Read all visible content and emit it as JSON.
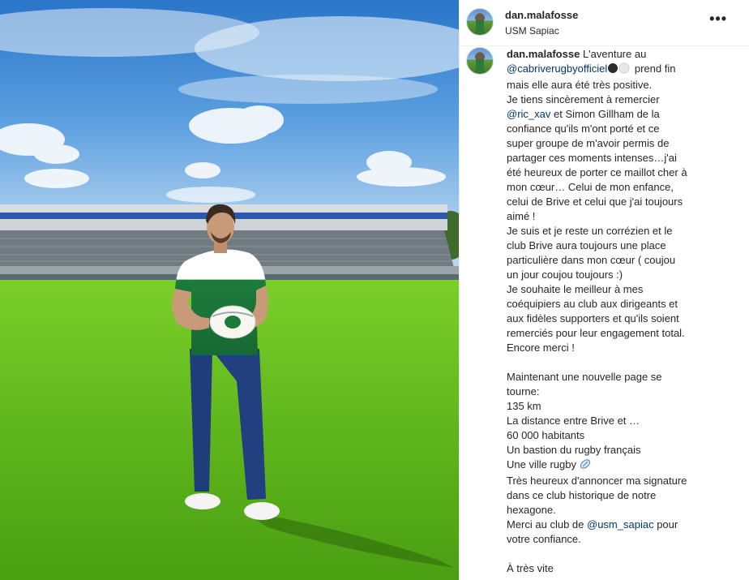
{
  "post": {
    "username": "dan.malafosse",
    "location": "USM Sapiac",
    "more_icon": "more-horizontal-icon",
    "more_symbol": "•••"
  },
  "caption": {
    "username": "dan.malafosse",
    "mention_cabrive": "@cabriverugbyofficiel",
    "mention_ric": "@ric_xav",
    "mention_usm": "@usm_sapiac",
    "line1_text": " L'aventure au",
    "line2_text": " prend fin",
    "line3": "mais elle aura été très positive.",
    "line4": "Je tiens sincèrement à remercier",
    "line5_text": " et Simon Gillham de la",
    "line6": "confiance qu'ils m'ont porté et ce",
    "line7": "super groupe de m'avoir permis de",
    "line8": "partager ces moments intenses…j'ai",
    "line9": "été heureux de porter ce maillot cher à",
    "line10": "mon cœur… Celui de mon enfance,",
    "line11": "celui de Brive et celui que j'ai toujours",
    "line12": "aimé !",
    "line13": "Je suis et je reste un corrézien et le",
    "line14": "club Brive aura toujours une place",
    "line15": "particulière dans mon cœur ( coujou",
    "line16": "un jour coujou toujours :)",
    "line17": "Je souhaite le meilleur à mes",
    "line18": "coéquipiers au club aux dirigeants et",
    "line19": "aux fidèles supporters et qu'ils soient",
    "line20": "remerciés pour leur engagement total.",
    "line21": "Encore merci !",
    "line22": "Maintenant une nouvelle page se",
    "line23": "tourne:",
    "line24": "135 km",
    "line25": "La distance entre Brive et …",
    "line26": "60 000 habitants",
    "line27": "Un bastion du rugby français",
    "line28": "Une ville rugby",
    "line29": "Très heureux d'annoncer ma signature",
    "line30": "dans ce club historique de notre",
    "line31": "hexagone.",
    "line32_text": "Merci au club de ",
    "line32_tail": " pour",
    "line33": "votre confiance.",
    "line34": "À très vite"
  },
  "colors": {
    "link": "#00376b",
    "text": "#262626",
    "border": "#efefef"
  }
}
